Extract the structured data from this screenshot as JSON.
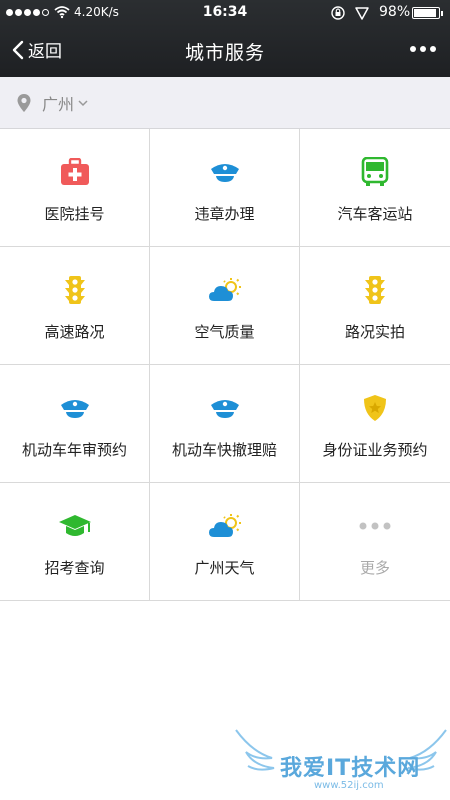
{
  "status_bar": {
    "speed": "4.20K/s",
    "time": "16:34",
    "battery": "98%",
    "battery_level": 0.98
  },
  "nav": {
    "back_label": "返回",
    "title": "城市服务"
  },
  "location": {
    "city": "广州"
  },
  "services": [
    {
      "label": "医院挂号",
      "icon": "medical-kit-icon"
    },
    {
      "label": "违章办理",
      "icon": "police-cap-icon"
    },
    {
      "label": "汽车客运站",
      "icon": "bus-icon"
    },
    {
      "label": "高速路况",
      "icon": "traffic-light-icon"
    },
    {
      "label": "空气质量",
      "icon": "cloud-sun-icon"
    },
    {
      "label": "路况实拍",
      "icon": "traffic-light-icon"
    },
    {
      "label": "机动车年审预约",
      "icon": "police-cap-icon"
    },
    {
      "label": "机动车快撤理赔",
      "icon": "police-cap-icon"
    },
    {
      "label": "身份证业务预约",
      "icon": "police-badge-icon"
    },
    {
      "label": "招考查询",
      "icon": "graduation-cap-icon"
    },
    {
      "label": "广州天气",
      "icon": "cloud-sun-icon"
    },
    {
      "label": "更多",
      "icon": "more-dots-icon"
    }
  ],
  "colors": {
    "header": "#23262a",
    "red": "#f05a5a",
    "blue": "#1e8fd6",
    "green": "#2fb82f",
    "yellow": "#f0c419",
    "gray": "#c2c2c2"
  },
  "watermark": {
    "text": "我爱IT技术网",
    "url": "www.52ij.com"
  }
}
